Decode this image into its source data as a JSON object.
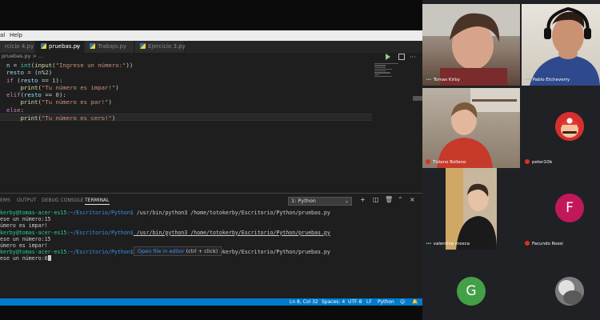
{
  "menubar": {
    "items": [
      "al",
      "Help"
    ]
  },
  "editor": {
    "tabs": [
      {
        "label": "rcicio 4.py"
      },
      {
        "label": "pruebas.py",
        "active": true
      },
      {
        "label": "Trabajo.py"
      },
      {
        "label": "Ejercicio 3.py"
      }
    ],
    "breadcrumb": "pruebas.py > ...",
    "code_lines": [
      "n = int(input(\"Ingrese un número:\"))",
      "resto = (n%2)",
      "if (resto == 1):",
      "    print(\"Tu número es impar!\")",
      "elif(resto == 0):",
      "    print(\"Tu número es par!\")",
      "else:",
      "    print(\"Tu número es cero!\")"
    ]
  },
  "panel": {
    "tabs": [
      "EMS",
      "OUTPUT",
      "DEBUG CONSOLE",
      "TERMINAL"
    ],
    "active_tab": "TERMINAL",
    "terminal_select": "1: Python",
    "icons": [
      "add-terminal-icon",
      "split-terminal-icon",
      "trash-icon",
      "chevron-up-icon",
      "close-icon"
    ],
    "terminal": {
      "prompt_user": "kerby@tomas-acer-es15",
      "prompt_path": ":~/Escritorio/Python$",
      "commands": [
        {
          "cmd": " /usr/bin/python3 /home/totokerby/Escritorio/Python/pruebas.py",
          "output": [
            "ese un número:15",
            "úmero es impar!"
          ]
        },
        {
          "cmd": " /usr/bin/python3 /home/totokerby/Escritorio/Python/pruebas.py",
          "output": [
            "ese un número:15",
            "úmero es impar!"
          ]
        },
        {
          "cmd": " /usr/bin/python3 /home/totokerby/Escritorio/Python/pruebas.py",
          "output": [
            "ese un número:0"
          ]
        }
      ],
      "tooltip": {
        "link": "Open file in editor",
        "hint": "(ctrl + click)"
      }
    }
  },
  "statusbar": {
    "position": "Ln 8, Col 32",
    "spaces": "Spaces: 4",
    "encoding": "UTF-8",
    "eol": "LF",
    "language": "Python"
  },
  "participants": [
    {
      "name": "Tomas Kirby",
      "muted": false,
      "speaking": true
    },
    {
      "name": "Pablo Etcheverry",
      "muted": false,
      "speaking": true
    },
    {
      "name": "Tiziano Bollano",
      "muted": true
    },
    {
      "name": "peter10b",
      "muted": true,
      "avatar": "mario-avatar-icon"
    },
    {
      "name": "valentino mosca",
      "muted": false,
      "speaking": true
    },
    {
      "name": "Facundo Rossi",
      "muted": true,
      "initial": "F",
      "color": "#c2185b"
    },
    {
      "initial": "G",
      "color": "#43a047"
    },
    {
      "avatar": "photo-avatar-icon"
    }
  ],
  "colors": {
    "editor_bg": "#1e1e1e",
    "statusbar": "#007acc",
    "meet_bg": "#202124",
    "mic_muted": "#d93025"
  }
}
